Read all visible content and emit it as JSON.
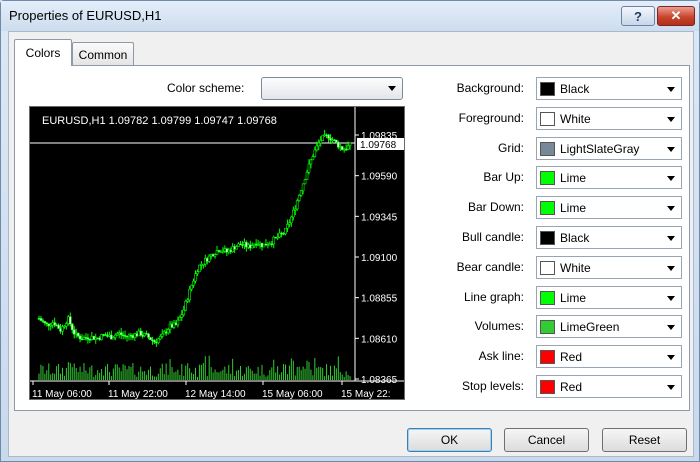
{
  "window": {
    "title": "Properties of EURUSD,H1",
    "help_label": "?",
    "close_label": "✕"
  },
  "tabs": [
    {
      "label": "Colors",
      "active": true
    },
    {
      "label": "Common",
      "active": false
    }
  ],
  "color_scheme": {
    "label": "Color scheme:",
    "value": ""
  },
  "properties": [
    {
      "label": "Background:",
      "value": "Black",
      "color": "#000000"
    },
    {
      "label": "Foreground:",
      "value": "White",
      "color": "#ffffff"
    },
    {
      "label": "Grid:",
      "value": "LightSlateGray",
      "color": "#778899"
    },
    {
      "label": "Bar Up:",
      "value": "Lime",
      "color": "#00ff00"
    },
    {
      "label": "Bar Down:",
      "value": "Lime",
      "color": "#00ff00"
    },
    {
      "label": "Bull candle:",
      "value": "Black",
      "color": "#000000"
    },
    {
      "label": "Bear candle:",
      "value": "White",
      "color": "#ffffff"
    },
    {
      "label": "Line graph:",
      "value": "Lime",
      "color": "#00ff00"
    },
    {
      "label": "Volumes:",
      "value": "LimeGreen",
      "color": "#32cd32"
    },
    {
      "label": "Ask line:",
      "value": "Red",
      "color": "#ff0000"
    },
    {
      "label": "Stop levels:",
      "value": "Red",
      "color": "#ff0000"
    }
  ],
  "buttons": {
    "ok": "OK",
    "cancel": "Cancel",
    "reset": "Reset"
  },
  "chart_data": {
    "type": "candlestick",
    "header": "EURUSD,H1  1.09782 1.09799 1.09747 1.09768",
    "current_price_label": "1.09768",
    "current_price": 1.09768,
    "y_ticks": [
      {
        "label": "1.09835",
        "value": 1.09835
      },
      {
        "label": "1.09590",
        "value": 1.0959
      },
      {
        "label": "1.09345",
        "value": 1.09345
      },
      {
        "label": "1.09100",
        "value": 1.091
      },
      {
        "label": "1.08855",
        "value": 1.08855
      },
      {
        "label": "1.08610",
        "value": 1.0861
      },
      {
        "label": "1.08365",
        "value": 1.08365
      }
    ],
    "x_ticks": [
      "11 May 06:00",
      "11 May 22:00",
      "12 May 14:00",
      "15 May 06:00",
      "15 May 22:"
    ],
    "ylim": [
      1.08365,
      1.09835
    ],
    "close_path": [
      1.0873,
      1.0869,
      1.0871,
      1.0866,
      1.0873,
      1.0863,
      1.0861,
      1.0862,
      1.0861,
      1.0863,
      1.0862,
      1.0864,
      1.0862,
      1.0863,
      1.0864,
      1.0862,
      1.0859,
      1.0862,
      1.0868,
      1.0869,
      1.0878,
      1.0892,
      1.0904,
      1.0908,
      1.0912,
      1.0915,
      1.0913,
      1.0916,
      1.0918,
      1.0916,
      1.0919,
      1.0917,
      1.0919,
      1.0922,
      1.0925,
      1.0935,
      1.0948,
      1.0961,
      1.0973,
      1.0981,
      1.0983,
      1.0979,
      1.0975,
      1.0977
    ]
  }
}
